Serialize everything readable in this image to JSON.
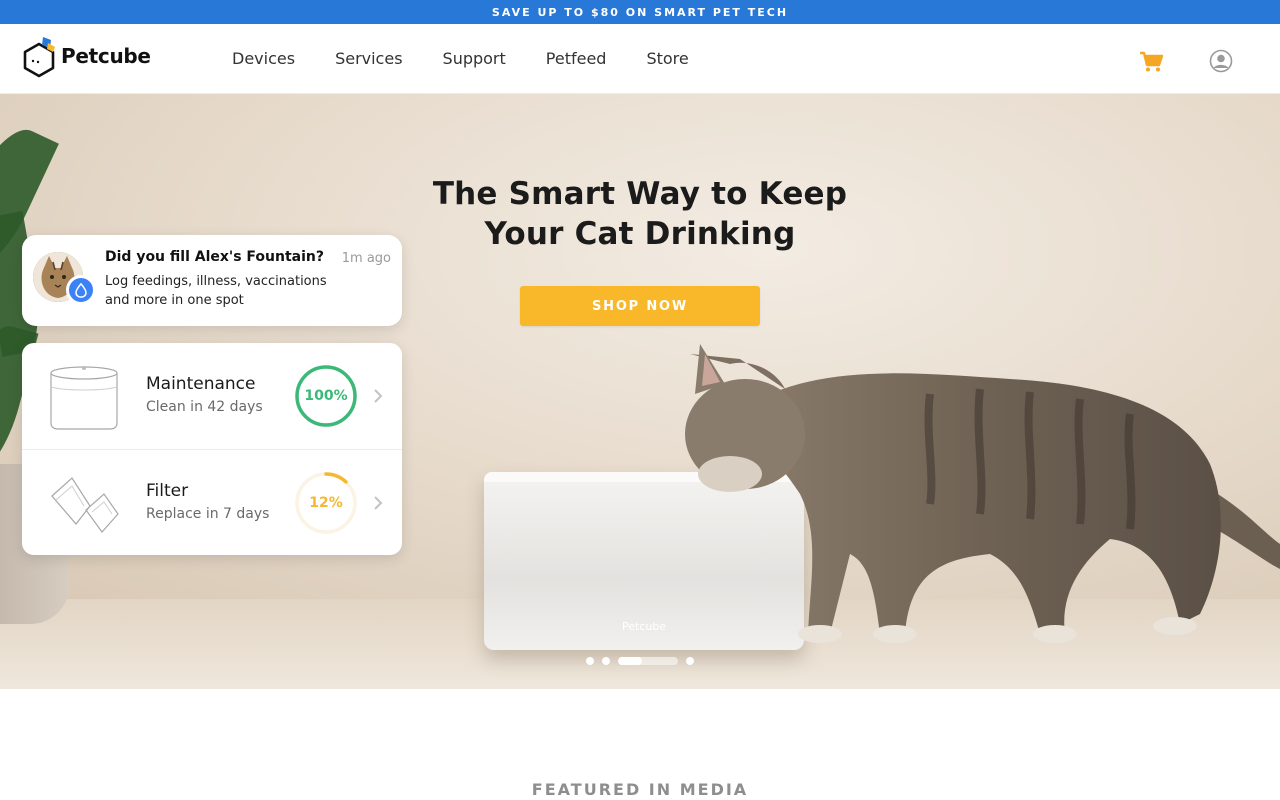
{
  "promo": {
    "text": "SAVE UP TO $80 ON SMART PET TECH",
    "color": "#2878d8"
  },
  "header": {
    "logo_text": "Petcube",
    "nav": [
      "Devices",
      "Services",
      "Support",
      "Petfeed",
      "Store"
    ],
    "icons": {
      "cart": "cart-icon",
      "account": "user-account-icon"
    }
  },
  "hero": {
    "title_line1": "The Smart Way to Keep",
    "title_line2": "Your Cat Drinking",
    "cta": "SHOP NOW",
    "cta_color": "#f9b82a",
    "fountain_label": "Petcube",
    "carousel": {
      "slides": 5,
      "active": 3
    }
  },
  "notification": {
    "title": "Did you fill Alex's Fountain?",
    "time": "1m ago",
    "body": "Log feedings, illness, vaccinations and more in one spot",
    "badge_icon": "water-drop-icon"
  },
  "status_card": {
    "rows": [
      {
        "title": "Maintenance",
        "subtitle": "Clean in 42 days",
        "percent_label": "100%",
        "percent": 100,
        "color": "#3cb878"
      },
      {
        "title": "Filter",
        "subtitle": "Replace in 7 days",
        "percent_label": "12%",
        "percent": 12,
        "color": "#f5b82e"
      }
    ]
  },
  "featured": {
    "heading": "FEATURED IN MEDIA"
  }
}
